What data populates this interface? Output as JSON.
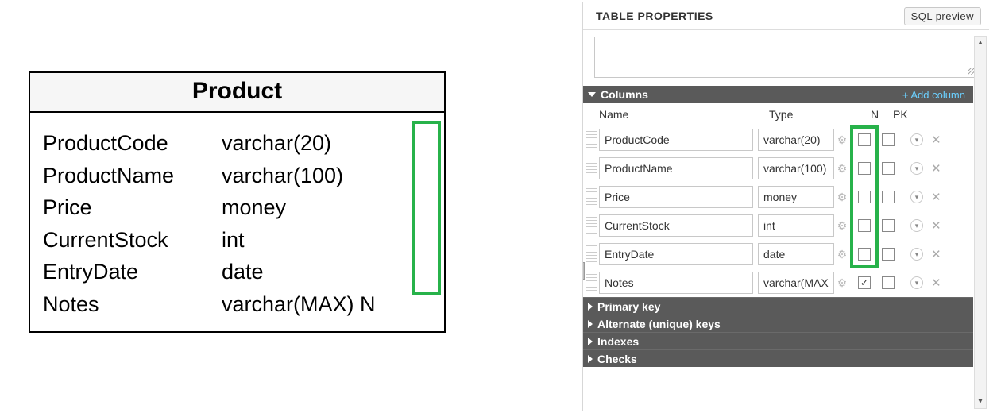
{
  "er": {
    "title": "Product",
    "rows": [
      {
        "name": "ProductCode",
        "type": "varchar(20)",
        "suffix": ""
      },
      {
        "name": "ProductName",
        "type": "varchar(100)",
        "suffix": ""
      },
      {
        "name": "Price",
        "type": "money",
        "suffix": ""
      },
      {
        "name": "CurrentStock",
        "type": "int",
        "suffix": ""
      },
      {
        "name": "EntryDate",
        "type": "date",
        "suffix": ""
      },
      {
        "name": "Notes",
        "type": "varchar(MAX)",
        "suffix": "N"
      }
    ]
  },
  "panel": {
    "title": "TABLE PROPERTIES",
    "sql_preview": "SQL preview",
    "columns_label": "Columns",
    "add_column": "+ Add column",
    "headers": {
      "name": "Name",
      "type": "Type",
      "n": "N",
      "pk": "PK"
    },
    "columns": [
      {
        "name": "ProductCode",
        "type": "varchar(20)",
        "nullable": false,
        "pk": false
      },
      {
        "name": "ProductName",
        "type": "varchar(100)",
        "nullable": false,
        "pk": false
      },
      {
        "name": "Price",
        "type": "money",
        "nullable": false,
        "pk": false
      },
      {
        "name": "CurrentStock",
        "type": "int",
        "nullable": false,
        "pk": false
      },
      {
        "name": "EntryDate",
        "type": "date",
        "nullable": false,
        "pk": false
      },
      {
        "name": "Notes",
        "type": "varchar(MAX",
        "nullable": true,
        "pk": false
      }
    ],
    "sections": {
      "primary_key": "Primary key",
      "alternate_keys": "Alternate (unique) keys",
      "indexes": "Indexes",
      "checks": "Checks"
    }
  }
}
